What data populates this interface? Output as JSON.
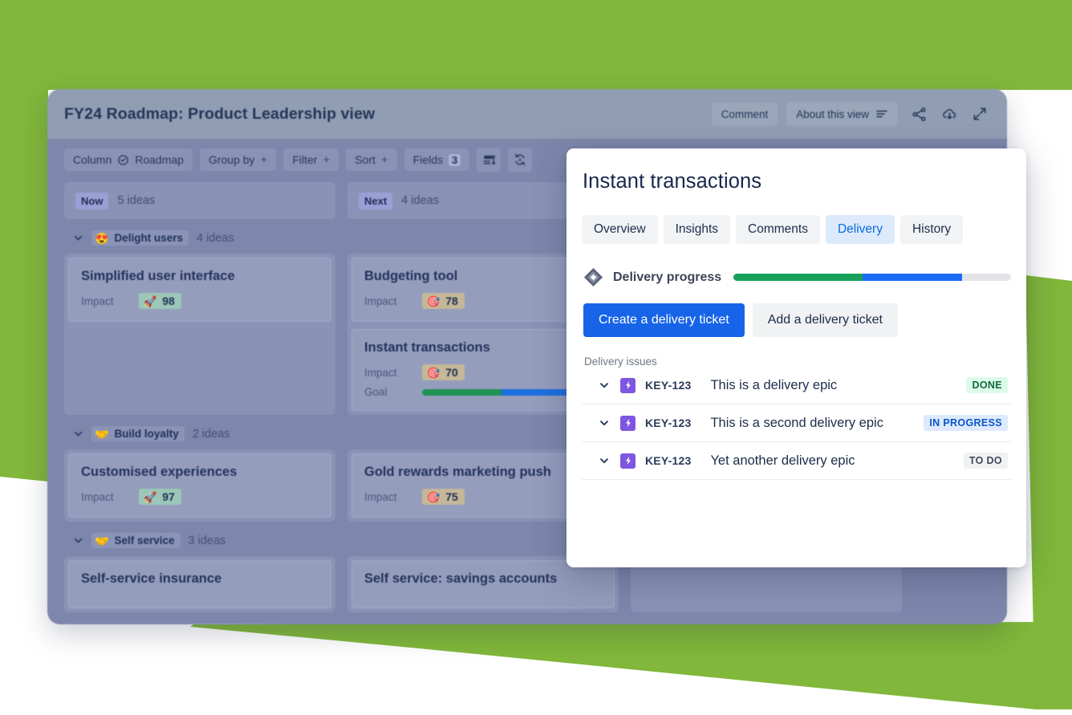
{
  "theme": {
    "green": "#81b73a",
    "window_bg": "#7d86ab",
    "header_bg": "#909db3",
    "accent_blue": "#1764e8",
    "progress_green": "#18a05a",
    "progress_blue": "#1b6cf2",
    "progress_track": "#e2e4e7"
  },
  "app_window": {
    "title": "FY24 Roadmap: Product Leadership view",
    "header_actions": {
      "comment_label": "Comment",
      "about_label": "About this view",
      "icons": [
        "list-icon",
        "share-icon",
        "cloud-download-icon",
        "expand-icon"
      ]
    },
    "toolbar": [
      {
        "label": "Column",
        "value": "Roadmap",
        "icon": "roadmap-circle-icon",
        "suffix": ""
      },
      {
        "label": "Group by",
        "value": "",
        "icon": "",
        "suffix": "+"
      },
      {
        "label": "Filter",
        "value": "",
        "icon": "",
        "suffix": "+"
      },
      {
        "label": "Sort",
        "value": "",
        "icon": "",
        "suffix": "+"
      },
      {
        "label": "Fields",
        "value": "",
        "icon": "",
        "suffix": "",
        "count": "3"
      }
    ],
    "toolbar_icon_buttons": [
      "row-height-icon",
      "auto-refresh-icon"
    ],
    "columns": [
      {
        "badge": "Now",
        "count": "5 ideas"
      },
      {
        "badge": "Next",
        "count": "4 ideas"
      }
    ],
    "groups": [
      {
        "emoji": "😍",
        "name": "Delight users",
        "count": "4 ideas",
        "cards": [
          {
            "title": "Simplified user interface",
            "impact_label": "Impact",
            "impact_value": "98",
            "impact_emoji": "🚀",
            "impact_style": "green",
            "tall": true
          },
          {
            "title": "Budgeting tool",
            "impact_label": "Impact",
            "impact_value": "78",
            "impact_emoji": "🎯",
            "impact_style": "tan"
          },
          {
            "title": "Instant transactions",
            "impact_label": "Impact",
            "impact_value": "70",
            "impact_emoji": "🎯",
            "impact_style": "tan",
            "goal_label": "Goal",
            "goal_green_pct": 47,
            "goal_blue_pct": 40
          }
        ]
      },
      {
        "emoji": "🤝",
        "name": "Build loyalty",
        "count": "2 ideas",
        "cards": [
          {
            "title": "Customised experiences",
            "impact_label": "Impact",
            "impact_value": "97",
            "impact_emoji": "🚀",
            "impact_style": "green"
          },
          {
            "title": "Gold rewards marketing push",
            "impact_label": "Impact",
            "impact_value": "75",
            "impact_emoji": "🎯",
            "impact_style": "tan"
          }
        ]
      },
      {
        "emoji": "🤝",
        "name": "Self service",
        "count": "3 ideas",
        "cards": [
          {
            "title": "Self-service insurance"
          },
          {
            "title": "Self service: savings accounts"
          }
        ]
      }
    ]
  },
  "modal": {
    "title": "Instant transactions",
    "tabs": [
      {
        "label": "Overview",
        "active": false
      },
      {
        "label": "Insights",
        "active": false
      },
      {
        "label": "Comments",
        "active": false
      },
      {
        "label": "Delivery",
        "active": true
      },
      {
        "label": "History",
        "active": false
      }
    ],
    "delivery": {
      "progress_label": "Delivery progress",
      "progress_green_pct": 46.5,
      "progress_blue_pct": 36,
      "progress_grey_pct": 17.5,
      "create_button": "Create a delivery ticket",
      "add_button": "Add a delivery ticket",
      "issues_heading": "Delivery issues",
      "issues": [
        {
          "key": "KEY-123",
          "summary": "This is a delivery epic",
          "status": "DONE",
          "status_style": "st-done"
        },
        {
          "key": "KEY-123",
          "summary": "This is a second delivery epic",
          "status": "IN PROGRESS",
          "status_style": "st-prog"
        },
        {
          "key": "KEY-123",
          "summary": "Yet another delivery epic",
          "status": "TO DO",
          "status_style": "st-todo"
        }
      ]
    }
  }
}
